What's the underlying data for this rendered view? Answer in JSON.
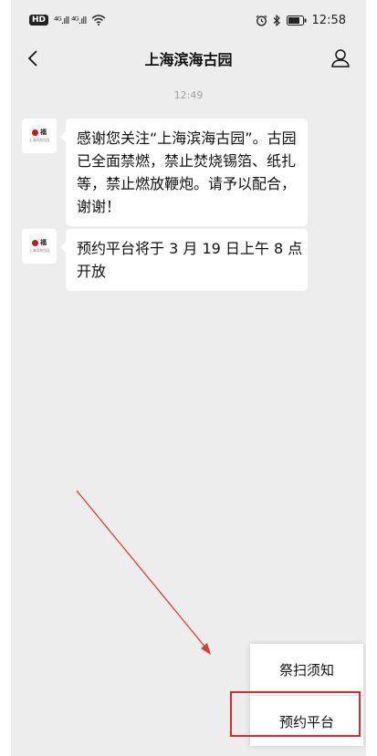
{
  "status_bar": {
    "hd_badge": "HD",
    "network": "⁴ᴳ.ıll ⁴ᴳ.ıll",
    "time": "12:58"
  },
  "nav": {
    "title": "上海滨海古园"
  },
  "chat": {
    "timestamp": "12:49",
    "avatar_logo": "福",
    "avatar_sub": "上海滨海古园",
    "messages": [
      {
        "lines": [
          "感谢您关注“上海滨海古园”。古园",
          "已全面禁燃，禁止焚烧锡箔、纸扎",
          "等，禁止燃放鞭炮。请予以配合，",
          "谢谢！"
        ]
      },
      {
        "lines": [
          "预约平台将于 3 月 19 日上午 8 点",
          "开放"
        ]
      }
    ]
  },
  "menu": {
    "items": [
      "祭扫须知",
      "预约平台"
    ]
  },
  "colors": {
    "chat_bg": "#ededed",
    "highlight": "#e02a23",
    "arrow": "#e53b2f"
  }
}
